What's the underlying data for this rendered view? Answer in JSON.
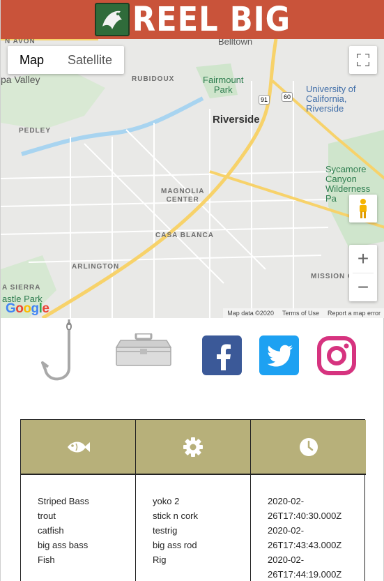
{
  "header": {
    "title": "REEL BIG",
    "logo_icon": "fish-logo-icon",
    "background": "#c9533a"
  },
  "map": {
    "type_controls": {
      "map_label": "Map",
      "satellite_label": "Satellite",
      "selected": "Map"
    },
    "labels": {
      "bellflower": "Belltown",
      "pa_valley": "pa Valley",
      "rubidoux": "RUBIDOUX",
      "fairmount_park": "Fairmount\nPark",
      "university": "University of\nCalifornia,\nRiverside",
      "riverside": "Riverside",
      "pedley": "PEDLEY",
      "sycamore": "Sycamore\nCanyon\nWilderness\nPa",
      "magnolia": "MAGNOLIA\nCENTER",
      "casa_blanca": "CASA BLANCA",
      "arlington": "ARLINGTON",
      "mission": "MISSION G",
      "la_sierra": "A SIERRA",
      "castle_park": "astle Park",
      "avon": "N AVON",
      "route_91": "91",
      "route_60": "60"
    },
    "google_logo": "Google",
    "footer": {
      "map_data": "Map data ©2020",
      "terms": "Terms of Use",
      "report": "Report a map error"
    },
    "zoom_in": "+",
    "zoom_out": "−"
  },
  "nav_icons": {
    "hook": "fishing-hook-icon",
    "tackle_box": "tackle-box-icon",
    "facebook": "facebook-icon",
    "twitter": "twitter-icon",
    "instagram": "instagram-icon",
    "colors": {
      "facebook": "#3b5998",
      "twitter": "#1da1f2",
      "instagram": "#d6337f"
    }
  },
  "catch_table": {
    "header_color": "#b7b07a",
    "columns": [
      {
        "icon": "fish-icon",
        "values": [
          "Striped Bass",
          "trout",
          "catfish",
          "big ass bass",
          "Fish"
        ]
      },
      {
        "icon": "gear-icon",
        "values": [
          "yoko 2",
          "stick n cork",
          "testrig",
          "big ass rod",
          "Rig"
        ]
      },
      {
        "icon": "clock-icon",
        "values": [
          "2020-02-",
          "26T17:40:30.000Z",
          "2020-02-",
          "26T17:43:43.000Z",
          "2020-02-",
          "26T17:44:19.000Z"
        ]
      }
    ]
  }
}
